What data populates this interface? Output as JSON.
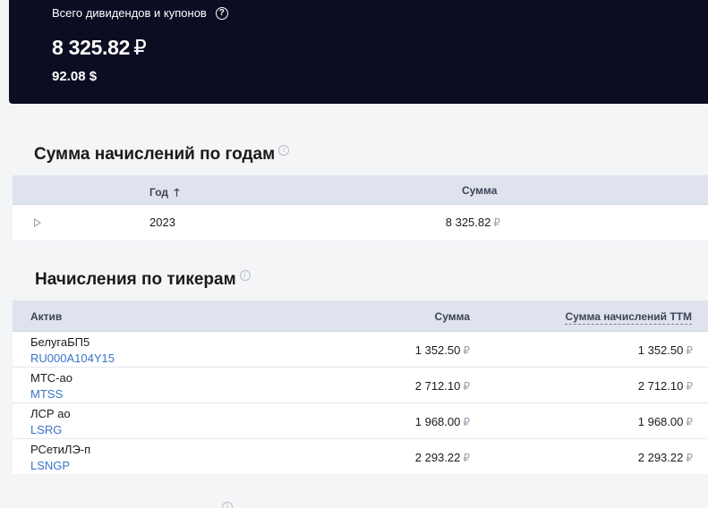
{
  "summary": {
    "label": "Всего дивидендов и купонов",
    "help_icon": "?",
    "total_rub": "8 325.82",
    "rub_symbol": "₽",
    "total_usd": "92.08 $"
  },
  "by_year": {
    "title": "Сумма начислений по годам",
    "info_icon": "i",
    "col_year": "Год",
    "sort_icon": "🡑",
    "col_sum": "Сумма",
    "rows": [
      {
        "year": "2023",
        "sum": "8 325.82",
        "cur": "₽"
      }
    ]
  },
  "by_ticker": {
    "title": "Начисления по тикерам",
    "info_icon": "i",
    "col_asset": "Актив",
    "col_sum": "Сумма",
    "col_ttm": "Сумма начислений TTM",
    "rows": [
      {
        "name": "БелугаБП5",
        "ticker": "RU000A104Y15",
        "sum": "1 352.50",
        "ttm": "1 352.50",
        "cur": "₽"
      },
      {
        "name": "МТС-ао",
        "ticker": "MTSS",
        "sum": "2 712.10",
        "ttm": "2 712.10",
        "cur": "₽"
      },
      {
        "name": "ЛСР ао",
        "ticker": "LSRG",
        "sum": "1 968.00",
        "ttm": "1 968.00",
        "cur": "₽"
      },
      {
        "name": "РСетиЛЭ-п",
        "ticker": "LSNGP",
        "sum": "2 293.22",
        "ttm": "2 293.22",
        "cur": "₽"
      }
    ]
  },
  "footer_info_icon": "i"
}
